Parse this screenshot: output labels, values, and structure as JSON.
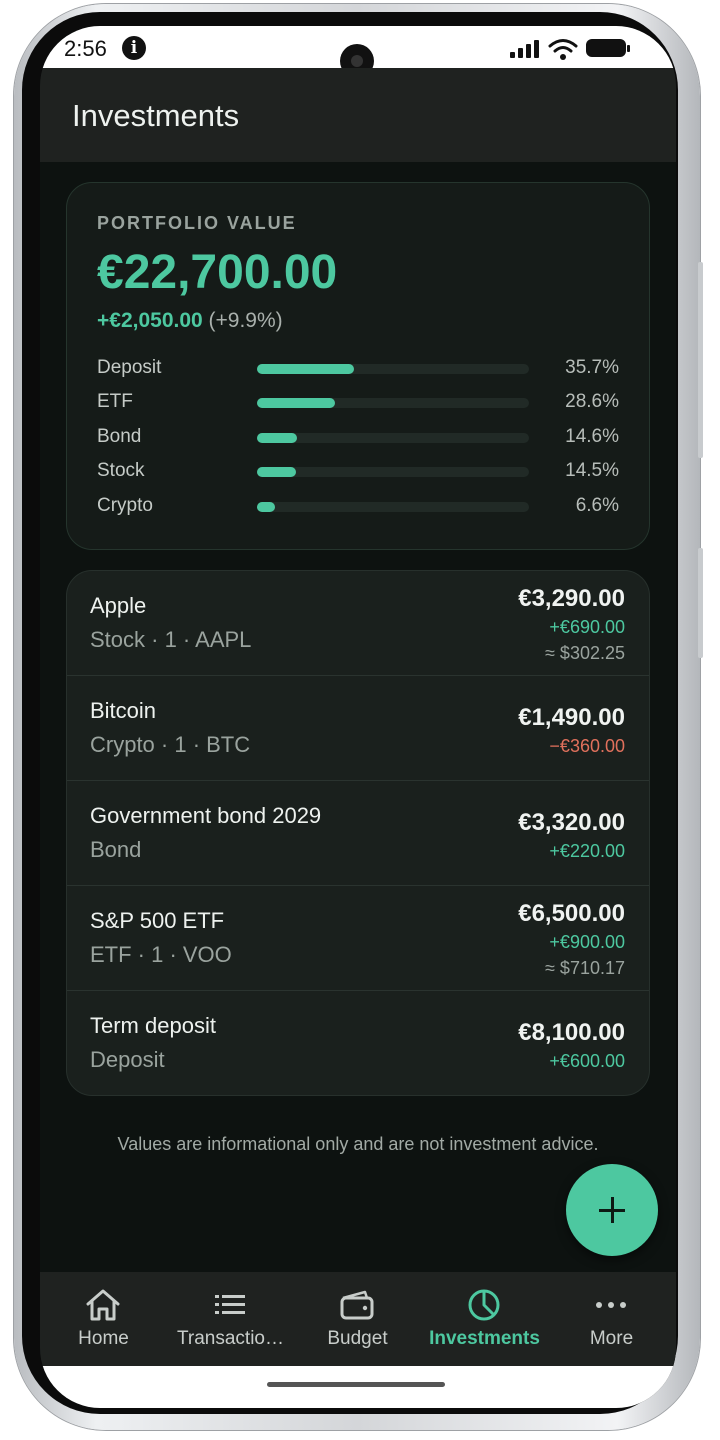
{
  "status_bar": {
    "time": "2:56",
    "info_glyph": "i"
  },
  "app_bar": {
    "title": "Investments"
  },
  "portfolio": {
    "label": "PORTFOLIO VALUE",
    "value": "€22,700.00",
    "change": "+€2,050.00",
    "change_pct": "(+9.9%)",
    "allocation": [
      {
        "name": "Deposit",
        "pct_label": "35.7%",
        "fraction": 0.357
      },
      {
        "name": "ETF",
        "pct_label": "28.6%",
        "fraction": 0.286
      },
      {
        "name": "Bond",
        "pct_label": "14.6%",
        "fraction": 0.146
      },
      {
        "name": "Stock",
        "pct_label": "14.5%",
        "fraction": 0.145
      },
      {
        "name": "Crypto",
        "pct_label": "6.6%",
        "fraction": 0.066
      }
    ]
  },
  "holdings": [
    {
      "name": "Apple",
      "sub": "Stock · 1 · AAPL",
      "value": "€3,290.00",
      "change": "+€690.00",
      "change_sign": "pos",
      "usd": "≈ $302.25"
    },
    {
      "name": "Bitcoin",
      "sub": "Crypto · 1 · BTC",
      "value": "€1,490.00",
      "change": "−€360.00",
      "change_sign": "neg",
      "usd": ""
    },
    {
      "name": "Government bond 2029",
      "sub": "Bond",
      "value": "€3,320.00",
      "change": "+€220.00",
      "change_sign": "pos",
      "usd": ""
    },
    {
      "name": "S&P 500 ETF",
      "sub": "ETF · 1 · VOO",
      "value": "€6,500.00",
      "change": "+€900.00",
      "change_sign": "pos",
      "usd": "≈ $710.17"
    },
    {
      "name": "Term deposit",
      "sub": "Deposit",
      "value": "€8,100.00",
      "change": "+€600.00",
      "change_sign": "pos",
      "usd": ""
    }
  ],
  "disclaimer": "Values are informational only and are not investment advice.",
  "fab": {
    "icon": "plus-icon"
  },
  "nav": [
    {
      "label": "Home",
      "icon": "home-icon"
    },
    {
      "label": "Transactio…",
      "icon": "list-icon"
    },
    {
      "label": "Budget",
      "icon": "wallet-icon"
    },
    {
      "label": "Investments",
      "icon": "pie-chart-icon",
      "active": true
    },
    {
      "label": "More",
      "icon": "more-dots-icon"
    }
  ],
  "colors": {
    "accent": "#4dc8a0",
    "negative": "#e0705c",
    "background": "#0d1210",
    "card": "#1a201d"
  }
}
